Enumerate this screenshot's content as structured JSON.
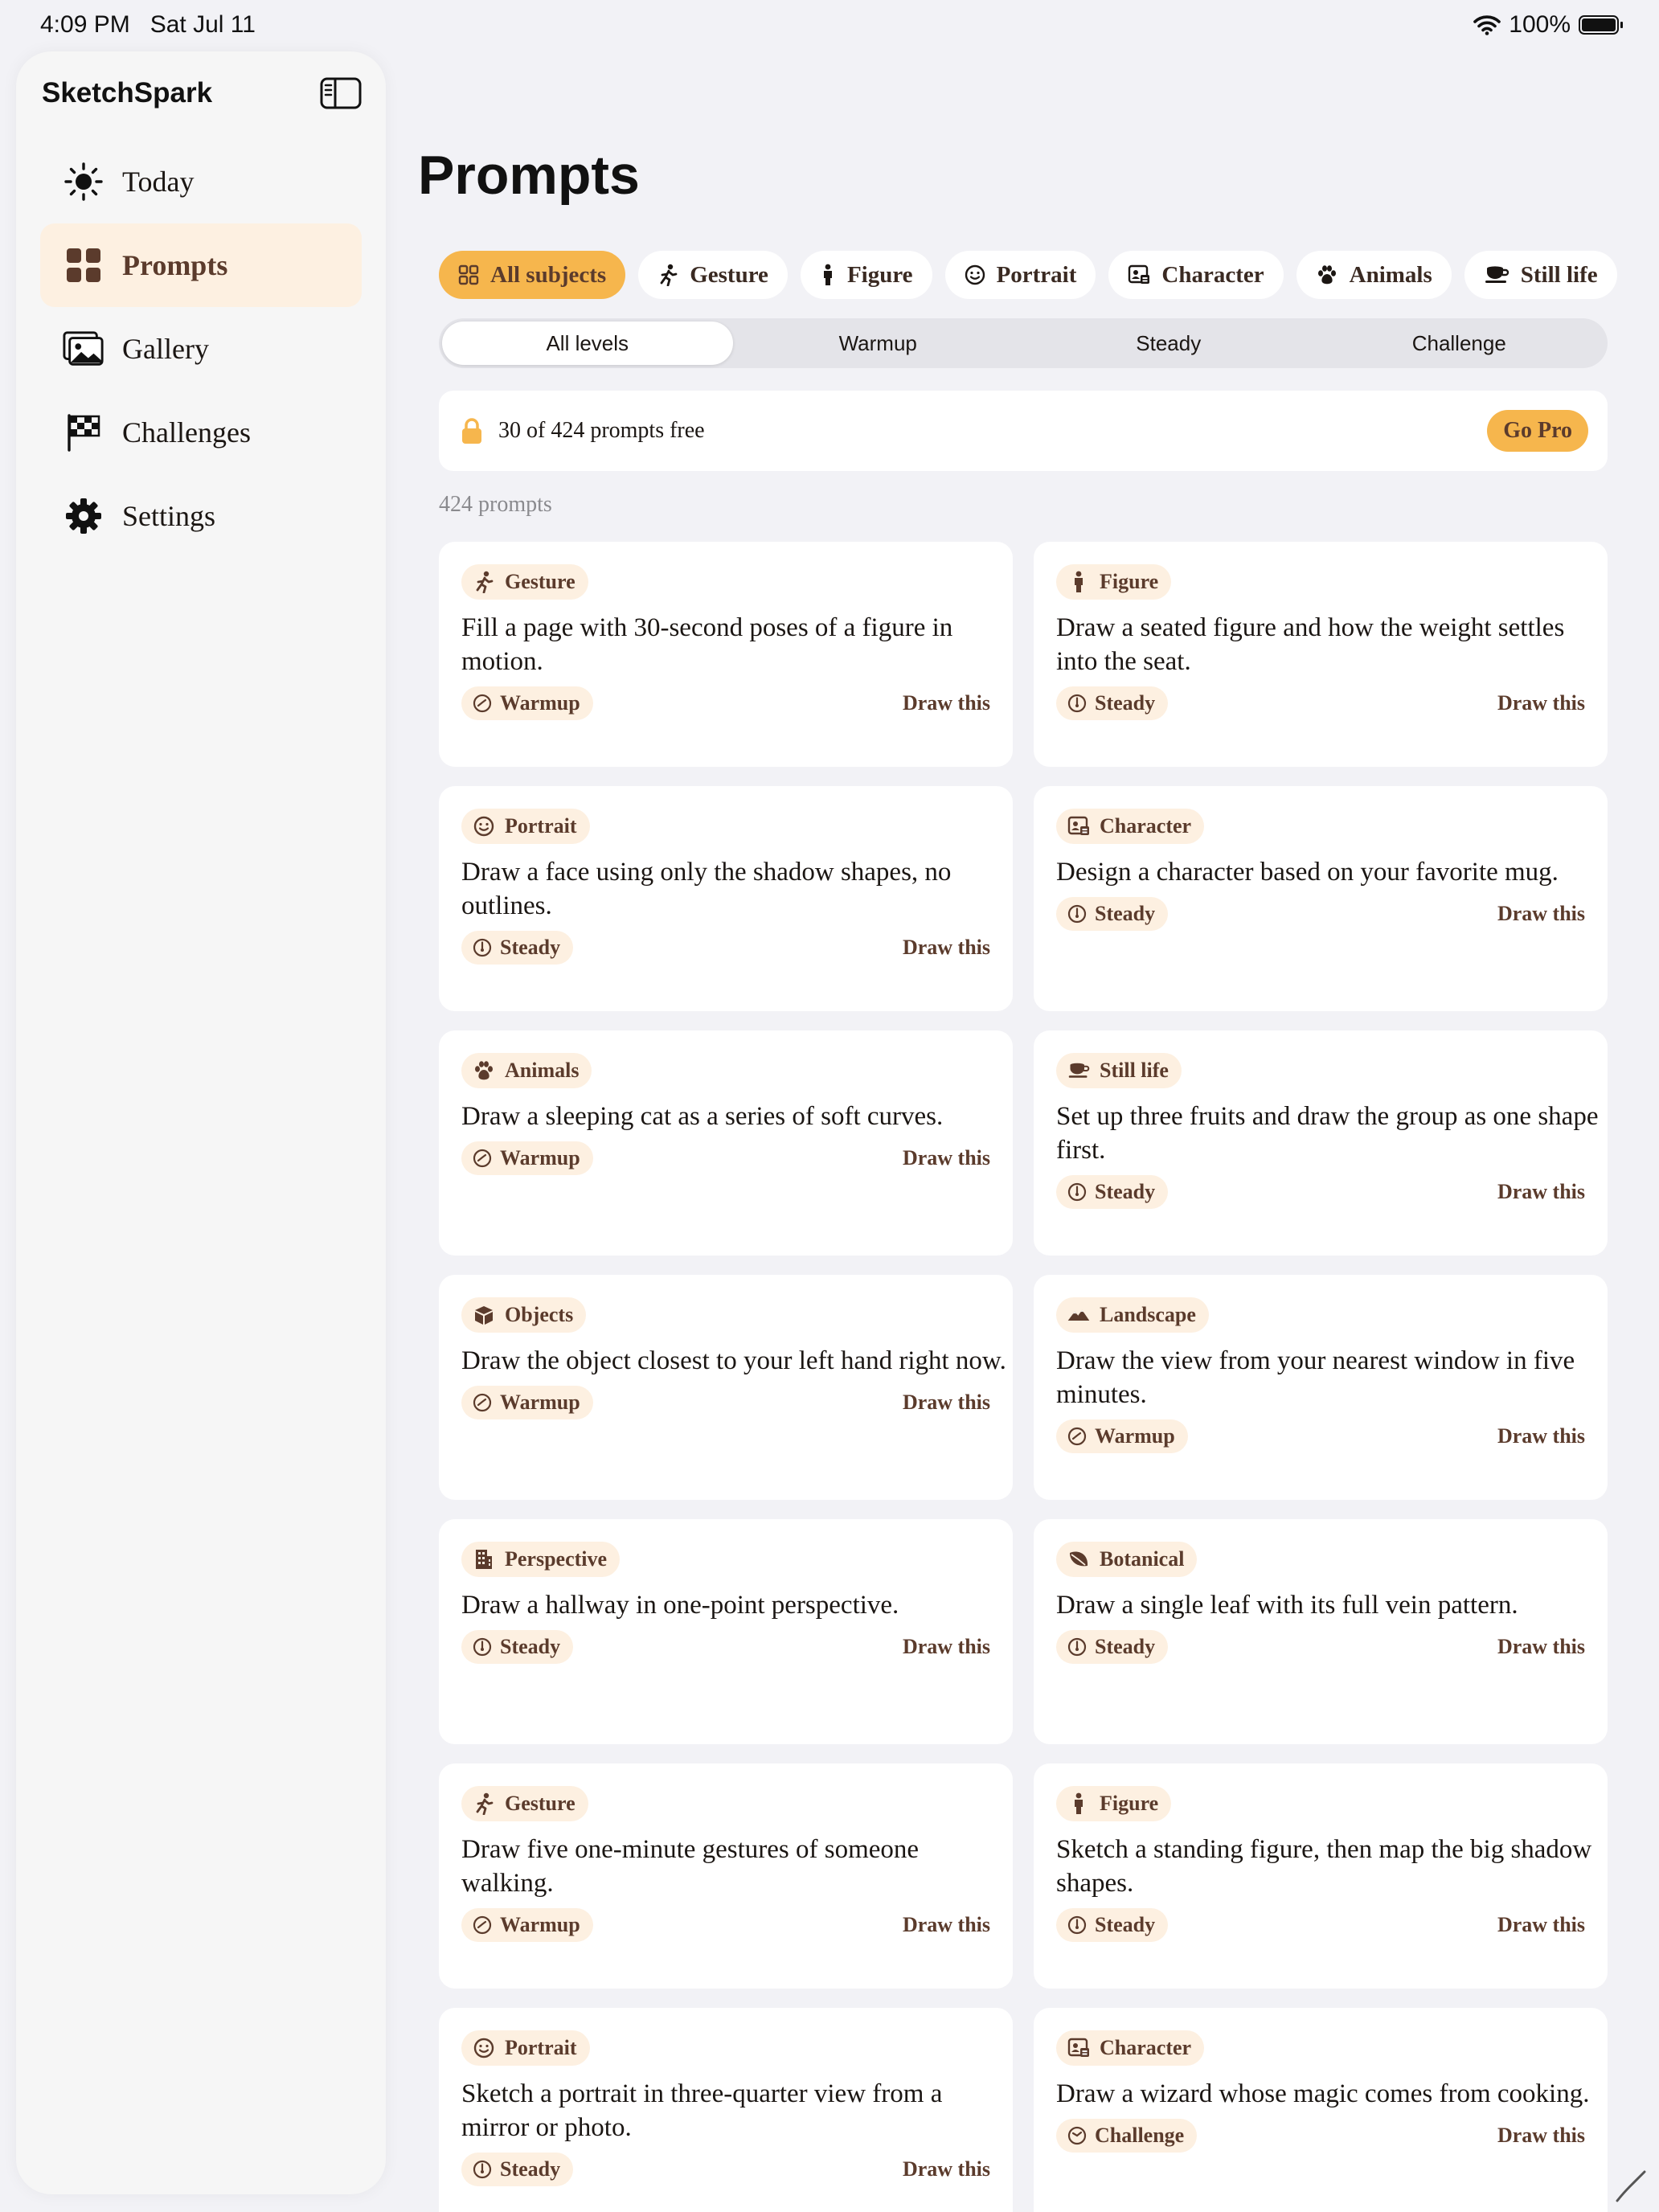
{
  "status_bar": {
    "time": "4:09 PM   Sat Jul 11",
    "battery": "100%"
  },
  "sidebar": {
    "app_title": "SketchSpark",
    "items": [
      {
        "label": "Today",
        "icon": "sun-icon"
      },
      {
        "label": "Prompts",
        "icon": "grid-icon",
        "active": true
      },
      {
        "label": "Gallery",
        "icon": "photos-icon"
      },
      {
        "label": "Challenges",
        "icon": "checkered-flag-icon"
      },
      {
        "label": "Settings",
        "icon": "gear-icon"
      }
    ]
  },
  "main": {
    "title": "Prompts",
    "subjects": [
      {
        "label": "All subjects",
        "icon": "grid-icon",
        "active": true
      },
      {
        "label": "Gesture",
        "icon": "running-figure-icon"
      },
      {
        "label": "Figure",
        "icon": "standing-figure-icon"
      },
      {
        "label": "Portrait",
        "icon": "smiley-face-icon"
      },
      {
        "label": "Character",
        "icon": "id-card-icon"
      },
      {
        "label": "Animals",
        "icon": "paw-icon"
      },
      {
        "label": "Still life",
        "icon": "cup-icon"
      }
    ],
    "levels": [
      {
        "label": "All levels",
        "active": true
      },
      {
        "label": "Warmup"
      },
      {
        "label": "Steady"
      },
      {
        "label": "Challenge"
      }
    ],
    "banner": {
      "text": "30 of 424 prompts free",
      "button": "Go Pro"
    },
    "count": "424 prompts",
    "cards": [
      {
        "subject": "Gesture",
        "icon": "running-figure-icon",
        "text": "Fill a page with 30-second poses of a figure in motion.",
        "level": "Warmup",
        "action": "Draw this"
      },
      {
        "subject": "Figure",
        "icon": "standing-figure-icon",
        "text": "Draw a seated figure and how the weight settles into the seat.",
        "level": "Steady",
        "action": "Draw this"
      },
      {
        "subject": "Portrait",
        "icon": "smiley-face-icon",
        "text": "Draw a face using only the shadow shapes, no outlines.",
        "level": "Steady",
        "action": "Draw this"
      },
      {
        "subject": "Character",
        "icon": "id-card-icon",
        "text": "Design a character based on your favorite mug.",
        "level": "Steady",
        "action": "Draw this"
      },
      {
        "subject": "Animals",
        "icon": "paw-icon",
        "text": "Draw a sleeping cat as a series of soft curves.",
        "level": "Warmup",
        "action": "Draw this"
      },
      {
        "subject": "Still life",
        "icon": "cup-icon",
        "text": "Set up three fruits and draw the group as one shape first.",
        "level": "Steady",
        "action": "Draw this"
      },
      {
        "subject": "Objects",
        "icon": "cube-icon",
        "text": "Draw the object closest to your left hand right now.",
        "level": "Warmup",
        "action": "Draw this"
      },
      {
        "subject": "Landscape",
        "icon": "mountains-icon",
        "text": "Draw the view from your nearest window in five minutes.",
        "level": "Warmup",
        "action": "Draw this"
      },
      {
        "subject": "Perspective",
        "icon": "building-icon",
        "text": "Draw a hallway in one-point perspective.",
        "level": "Steady",
        "action": "Draw this"
      },
      {
        "subject": "Botanical",
        "icon": "leaf-icon",
        "text": "Draw a single leaf with its full vein pattern.",
        "level": "Steady",
        "action": "Draw this"
      },
      {
        "subject": "Gesture",
        "icon": "running-figure-icon",
        "text": "Draw five one-minute gestures of someone walking.",
        "level": "Warmup",
        "action": "Draw this"
      },
      {
        "subject": "Figure",
        "icon": "standing-figure-icon",
        "text": "Sketch a standing figure, then map the big shadow shapes.",
        "level": "Steady",
        "action": "Draw this"
      },
      {
        "subject": "Portrait",
        "icon": "smiley-face-icon",
        "text": "Sketch a portrait in three-quarter view from a mirror or photo.",
        "level": "Steady",
        "action": "Draw this"
      },
      {
        "subject": "Character",
        "icon": "id-card-icon",
        "text": "Draw a wizard whose magic comes from cooking.",
        "level": "Challenge",
        "action": "Draw this"
      }
    ]
  },
  "colors": {
    "accent": "#f6b64d",
    "tag_bg": "#fdf0e1",
    "brown": "#5b3b2c",
    "background": "#f2f2f6"
  }
}
